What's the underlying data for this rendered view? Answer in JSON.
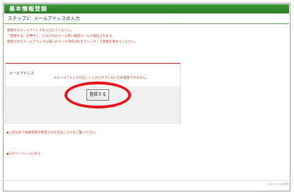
{
  "header": {
    "title": "基本情報登録"
  },
  "step": {
    "title": "ステップ1：メールアドレスの入力"
  },
  "intro": {
    "lines": [
      "登録するメールアドレスを入力してください。",
      "「登録する」を押すと、入力されたメール宛に確認メールが送信されます。",
      "登録されたメールアドレスに届いたメール内のURLをクリックして登録を進めてください。"
    ]
  },
  "form": {
    "email_label": "メールアドレス",
    "error_message": "※メールアドレスが正しく入力されていないため登録できません。",
    "email_value": "",
    "email_placeholder": "",
    "submit_label": "登録する"
  },
  "links": {
    "help": "◆上記以外で会員登録を希望される方はこちらをご覧ください。",
    "back": "◆ログインページに戻る"
  },
  "footer": {
    "note": "このページの先頭へ"
  },
  "colors": {
    "header_green": "#2c7a26",
    "accent_red": "#c0392b",
    "highlight_ring": "#e3141c"
  }
}
